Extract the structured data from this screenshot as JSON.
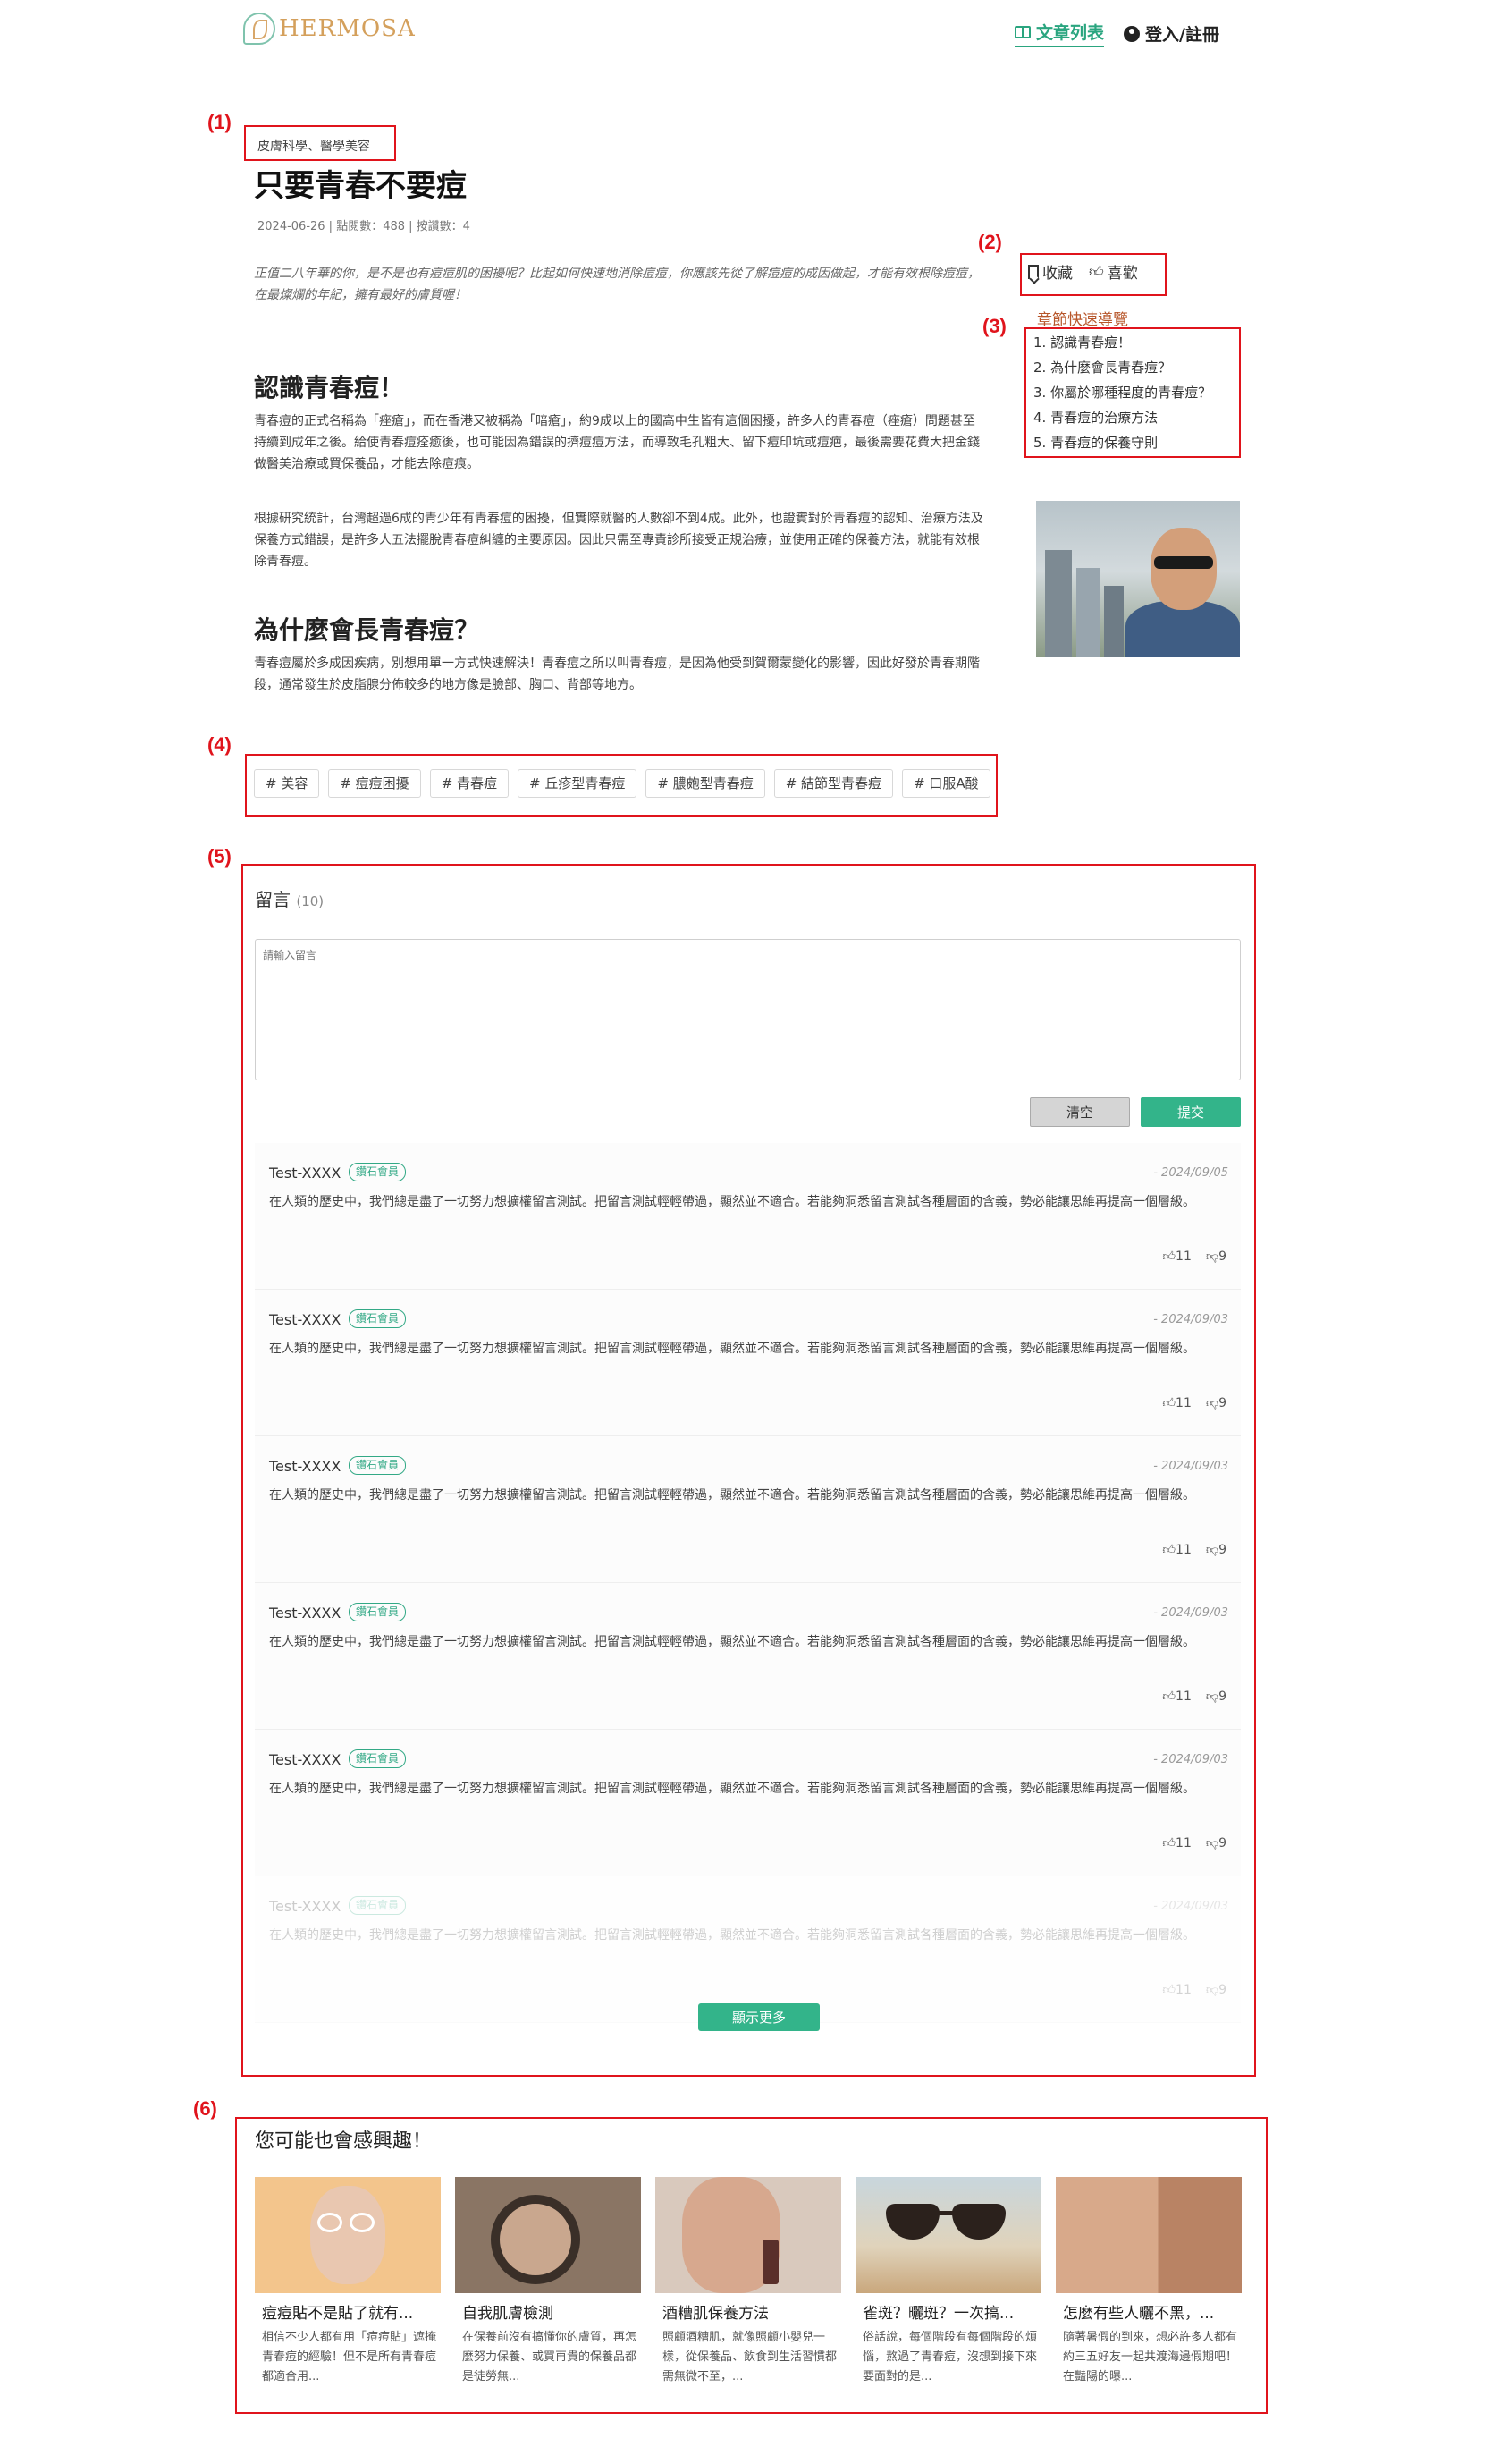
{
  "header": {
    "logo_text": "HERMOSA",
    "nav_articles": "文章列表",
    "nav_login": "登入/註冊"
  },
  "annotations": [
    "(1)",
    "(2)",
    "(3)",
    "(4)",
    "(5)",
    "(6)"
  ],
  "article": {
    "category": "皮膚科學、醫學美容",
    "title": "只要青春不要痘",
    "meta": "2024-06-26  |  點閱數：488  |  按讚數：4",
    "intro": "正值二八年華的你，是不是也有痘痘肌的困擾呢？比起如何快速地消除痘痘，你應該先從了解痘痘的成因做起，才能有效根除痘痘，在最燦爛的年紀，擁有最好的膚質喔！",
    "sections": [
      {
        "heading": "認識青春痘！",
        "paragraphs": [
          "青春痘的正式名稱為「痤瘡」，而在香港又被稱為「暗瘡」，約9成以上的國高中生皆有這個困擾，許多人的青春痘（痤瘡）問題甚至持續到成年之後。給使青春痘痊癒後，也可能因為錯誤的擠痘痘方法，而導致毛孔粗大、留下痘印坑或痘疤，最後需要花費大把金錢做醫美治療或買保養品，才能去除痘痕。",
          "根據研究統計，台灣超過6成的青少年有青春痘的困擾，但實際就醫的人數卻不到4成。此外，也證實對於青春痘的認知、治療方法及保養方式錯誤，是許多人五法擺脫青春痘糾纏的主要原因。因此只需至專責診所接受正規治療，並使用正確的保養方法，就能有效根除青春痘。"
        ]
      },
      {
        "heading": "為什麼會長青春痘？",
        "paragraphs": [
          "青春痘屬於多成因疾病，別想用單一方式快速解決！青春痘之所以叫青春痘，是因為他受到賀爾蒙變化的影響，因此好發於青春期階段，通常發生於皮脂腺分佈較多的地方像是臉部、胸口、背部等地方。"
        ]
      }
    ]
  },
  "actions": {
    "bookmark": "收藏",
    "like": "喜歡"
  },
  "toc": {
    "title": "章節快速導覽",
    "items": [
      "1. 認識青春痘！",
      "2. 為什麼會長青春痘？",
      "3. 你屬於哪種程度的青春痘？",
      "4. 青春痘的治療方法",
      "5. 青春痘的保養守則"
    ]
  },
  "tags": [
    "# 美容",
    "# 痘痘困擾",
    "# 青春痘",
    "# 丘疹型青春痘",
    "# 膿皰型青春痘",
    "# 結節型青春痘",
    "# 口服A酸"
  ],
  "comments_section": {
    "title": "留言",
    "count": "(10)",
    "placeholder": "請輸入留言",
    "clear_button": "清空",
    "submit_button": "提交",
    "more_button": "顯示更多",
    "items": [
      {
        "user": "Test-XXXX",
        "badge": "鑽石會員",
        "date": "- 2024/09/05",
        "text": "在人類的歷史中，我們總是盡了一切努力想擴權留言測試。把留言測試輕輕帶過，顯然並不適合。若能夠洞悉留言測試各種層面的含義，勢必能讓思維再提高一個層級。",
        "likes": "11",
        "dislikes": "9"
      },
      {
        "user": "Test-XXXX",
        "badge": "鑽石會員",
        "date": "- 2024/09/03",
        "text": "在人類的歷史中，我們總是盡了一切努力想擴權留言測試。把留言測試輕輕帶過，顯然並不適合。若能夠洞悉留言測試各種層面的含義，勢必能讓思維再提高一個層級。",
        "likes": "11",
        "dislikes": "9"
      },
      {
        "user": "Test-XXXX",
        "badge": "鑽石會員",
        "date": "- 2024/09/03",
        "text": "在人類的歷史中，我們總是盡了一切努力想擴權留言測試。把留言測試輕輕帶過，顯然並不適合。若能夠洞悉留言測試各種層面的含義，勢必能讓思維再提高一個層級。",
        "likes": "11",
        "dislikes": "9"
      },
      {
        "user": "Test-XXXX",
        "badge": "鑽石會員",
        "date": "- 2024/09/03",
        "text": "在人類的歷史中，我們總是盡了一切努力想擴權留言測試。把留言測試輕輕帶過，顯然並不適合。若能夠洞悉留言測試各種層面的含義，勢必能讓思維再提高一個層級。",
        "likes": "11",
        "dislikes": "9"
      },
      {
        "user": "Test-XXXX",
        "badge": "鑽石會員",
        "date": "- 2024/09/03",
        "text": "在人類的歷史中，我們總是盡了一切努力想擴權留言測試。把留言測試輕輕帶過，顯然並不適合。若能夠洞悉留言測試各種層面的含義，勢必能讓思維再提高一個層級。",
        "likes": "11",
        "dislikes": "9"
      },
      {
        "user": "Test-XXXX",
        "badge": "鑽石會員",
        "date": "- 2024/09/03",
        "text": "在人類的歷史中，我們總是盡了一切努力想擴權留言測試。把留言測試輕輕帶過，顯然並不適合。若能夠洞悉留言測試各種層面的含義，勢必能讓思維再提高一個層級。",
        "likes": "11",
        "dislikes": "9"
      }
    ]
  },
  "related": {
    "title": "您可能也會感興趣！",
    "cards": [
      {
        "title": "痘痘貼不是貼了就有...",
        "desc": "相信不少人都有用「痘痘貼」遮掩青春痘的經驗！但不是所有青春痘都適合用..."
      },
      {
        "title": "自我肌膚檢測",
        "desc": "在保養前沒有搞懂你的膚質，再怎麼努力保養、或買再貴的保養品都是徒勞無..."
      },
      {
        "title": "酒糟肌保養方法",
        "desc": "照顧酒糟肌，就像照顧小嬰兒一樣，從保養品、飲食到生活習慣都需無微不至，..."
      },
      {
        "title": "雀斑？曬斑？一次搞...",
        "desc": "俗話說，每個階段有每個階段的煩惱，熬過了青春痘，沒想到接下來要面對的是..."
      },
      {
        "title": "怎麼有些人曬不黑，...",
        "desc": "隨著暑假的到來，想必許多人都有約三五好友一起共渡海邊假期吧！在豔陽的曝..."
      }
    ]
  }
}
